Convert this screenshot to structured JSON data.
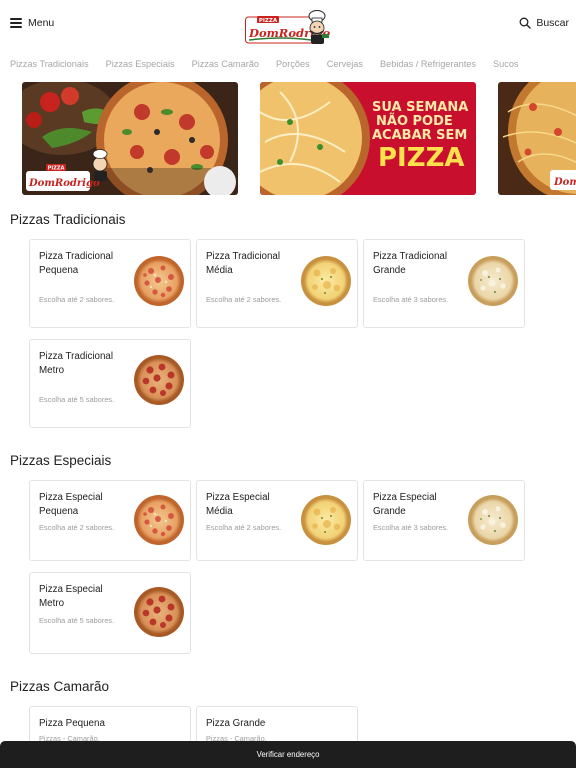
{
  "header": {
    "menu_label": "Menu",
    "search_label": "Buscar",
    "logo_text": "DomRodrigo",
    "logo_tag": "PIZZA"
  },
  "categories": [
    "Pizzas Tradicionais",
    "Pizzas Especiais",
    "Pizzas Camarão",
    "Porções",
    "Cervejas",
    "Bebidas / Refrigerantes",
    "Sucos"
  ],
  "banners": [
    {
      "logo_text": "DomRodrigo",
      "logo_tag": "PIZZA"
    },
    {
      "lines": [
        "SUA SEMANA",
        "NÃO PODE",
        "ACABAR SEM"
      ],
      "highlight": "PIZZA"
    },
    {
      "logo_text": "Dom"
    }
  ],
  "sections": [
    {
      "title": "Pizzas Tradicionais",
      "items": [
        {
          "name": "Pizza Tradicional Pequena",
          "desc": "Escolha até 2 sabores.",
          "image": "pizza-pepperoni-icon"
        },
        {
          "name": "Pizza Tradicional Média",
          "desc": "Escolha até 2 sabores.",
          "image": "pizza-cheese-icon"
        },
        {
          "name": "Pizza Tradicional Grande",
          "desc": "Escolha até 3 sabores.",
          "image": "pizza-light-icon"
        },
        {
          "name": "Pizza Tradicional Metro",
          "desc": "Escolha até 5 sabores.",
          "image": "pizza-salami-icon"
        }
      ]
    },
    {
      "title": "Pizzas Especiais",
      "items": [
        {
          "name": "Pizza Especial Pequena",
          "desc": "Escolha até 2 sabores.",
          "image": "pizza-pepperoni-icon"
        },
        {
          "name": "Pizza Especial Média",
          "desc": "Escolha até 2 sabores.",
          "image": "pizza-cheese-icon"
        },
        {
          "name": "Pizza Especial Grande",
          "desc": "Escolha até 3 sabores.",
          "image": "pizza-light-icon"
        },
        {
          "name": "Pizza Especial Metro",
          "desc": "Escolha até 5 sabores.",
          "image": "pizza-salami-icon"
        }
      ]
    },
    {
      "title": "Pizzas Camarão",
      "items": [
        {
          "name": "Pizza Pequena",
          "desc": "Pizzas - Camarão.",
          "image": ""
        },
        {
          "name": "Pizza Grande",
          "desc": "Pizzas - Camarão.",
          "image": ""
        }
      ]
    }
  ],
  "footer": {
    "cta_label": "Verificar endereço"
  },
  "colors": {
    "brand_red": "#c8231e",
    "brand_green": "#2f7d32",
    "tab_inactive": "#a6a6a6",
    "bottom_bar": "#1e1e1e"
  }
}
